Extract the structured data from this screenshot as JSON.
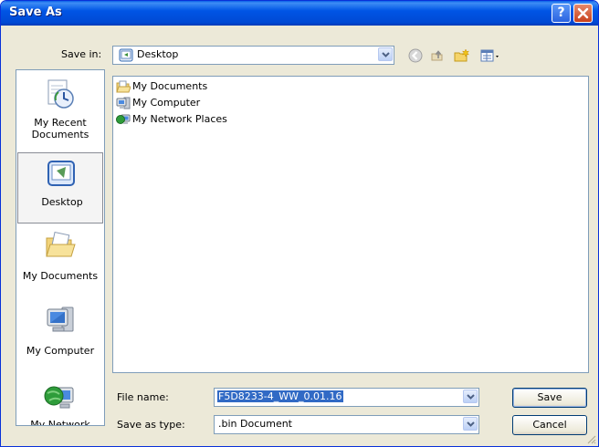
{
  "window": {
    "title": "Save As"
  },
  "toolbar": {
    "save_in_label": "Save in:",
    "location": "Desktop"
  },
  "places": [
    {
      "id": "recent",
      "label1": "My Recent",
      "label2": "Documents"
    },
    {
      "id": "desktop",
      "label1": "Desktop",
      "selected": true
    },
    {
      "id": "mydocs",
      "label1": "My Documents"
    },
    {
      "id": "mycomputer",
      "label1": "My Computer"
    },
    {
      "id": "mynetwork",
      "label1": "My Network"
    }
  ],
  "files": [
    {
      "name": "My Documents",
      "icon": "documents-folder-icon"
    },
    {
      "name": "My Computer",
      "icon": "computer-icon"
    },
    {
      "name": "My Network Places",
      "icon": "network-places-icon"
    }
  ],
  "form": {
    "file_name_label": "File name:",
    "file_name_value": "F5D8233-4_WW_0.01.16",
    "save_as_type_label": "Save as type:",
    "save_as_type_value": ".bin Document"
  },
  "buttons": {
    "save": "Save",
    "cancel": "Cancel"
  },
  "colors": {
    "titlebar": "#0055e5",
    "dialog": "#ece9d8",
    "selection": "#316ac5"
  }
}
